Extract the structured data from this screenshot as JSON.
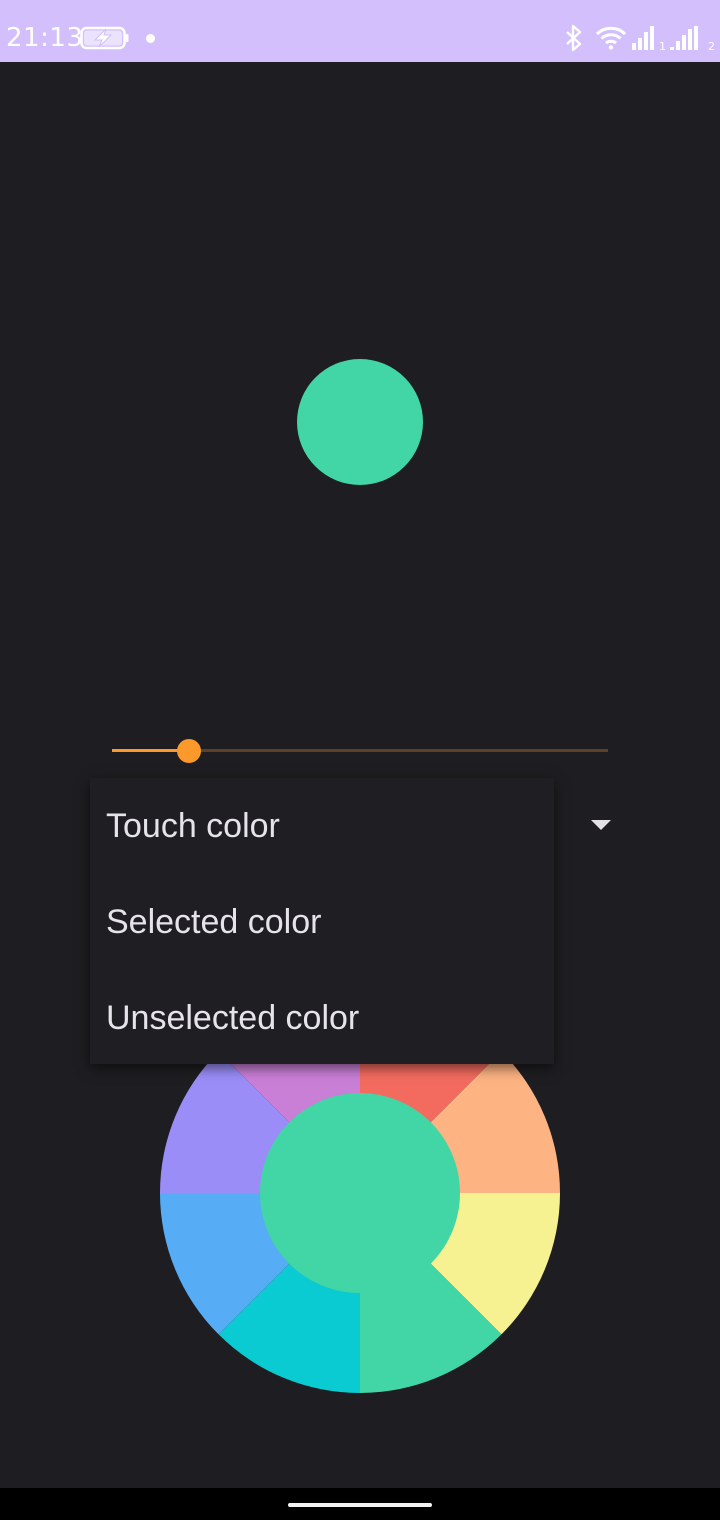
{
  "status_bar": {
    "time": "21:13",
    "sim1_label": "1",
    "sim2_label": "2",
    "background_color": "#d3bffb",
    "icons": [
      "charging-battery-icon",
      "notification-dot-icon",
      "bluetooth-icon",
      "wifi-icon",
      "signal-sim1-icon",
      "signal-sim2-icon"
    ]
  },
  "preview": {
    "color": "#42d5a5"
  },
  "slider": {
    "value_fraction": 0.09,
    "active_color": "#fb9a2a",
    "track_color": "#5c4128"
  },
  "dropdown": {
    "expanded": true,
    "arrow_icon": "dropdown-arrow-icon",
    "options": [
      {
        "label": "Touch color"
      },
      {
        "label": "Selected color"
      },
      {
        "label": "Unselected color"
      }
    ]
  },
  "color_wheel": {
    "center_color": "#42d5a5",
    "segments": [
      {
        "color": "#f36b5f"
      },
      {
        "color": "#fdb382"
      },
      {
        "color": "#f6f191"
      },
      {
        "color": "#42d5a5"
      },
      {
        "color": "#0acbd2"
      },
      {
        "color": "#57acf6"
      },
      {
        "color": "#9a8df8"
      },
      {
        "color": "#c97fd6"
      }
    ]
  },
  "colors": {
    "background": "#1e1d21",
    "menu_background": "#1f1e23",
    "menu_text": "#e6e4ea"
  }
}
